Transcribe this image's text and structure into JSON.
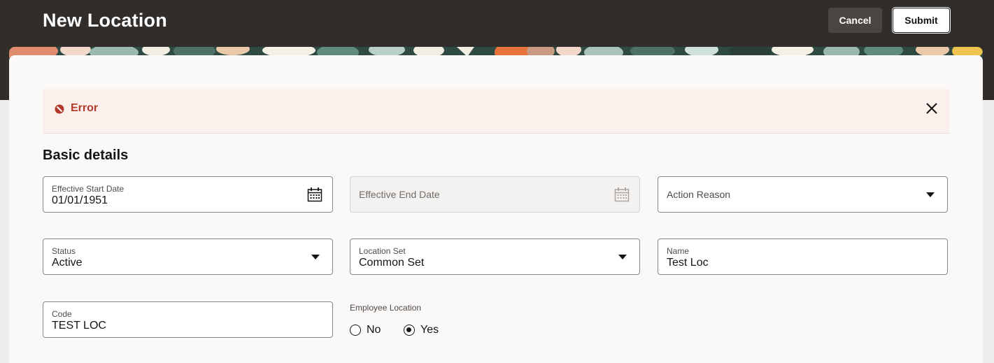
{
  "header": {
    "title": "New Location",
    "cancel_label": "Cancel",
    "submit_label": "Submit"
  },
  "error": {
    "title": "Error"
  },
  "section": {
    "title": "Basic details"
  },
  "fields": {
    "effective_start_date": {
      "label": "Effective Start Date",
      "value": "01/01/1951"
    },
    "effective_end_date": {
      "placeholder": "Effective End Date"
    },
    "action_reason": {
      "placeholder": "Action Reason"
    },
    "status": {
      "label": "Status",
      "value": "Active"
    },
    "location_set": {
      "label": "Location Set",
      "value": "Common Set"
    },
    "name": {
      "label": "Name",
      "value": "Test Loc"
    },
    "code": {
      "label": "Code",
      "value": "TEST LOC"
    }
  },
  "employee_location": {
    "label": "Employee Location",
    "options": [
      {
        "label": "No",
        "selected": false
      },
      {
        "label": "Yes",
        "selected": true
      }
    ]
  },
  "colors": {
    "header_bg": "#312d2a",
    "error_text": "#b23a2a",
    "error_bg": "#fcf0ec",
    "card_bg": "#fbf9f8"
  },
  "icons": {
    "error": "error-icon",
    "close": "close-icon",
    "calendar": "calendar-icon",
    "dropdown": "chevron-down-icon"
  }
}
